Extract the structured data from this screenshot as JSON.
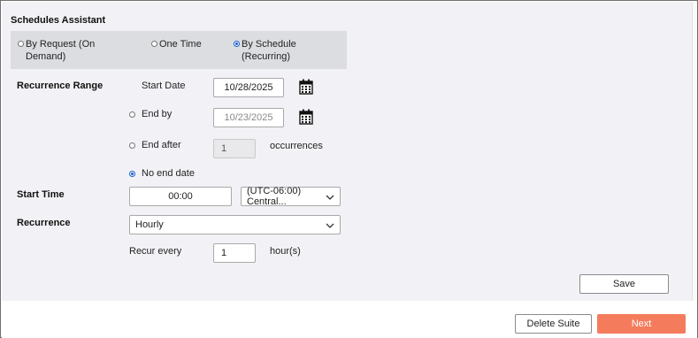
{
  "title": "Schedules Assistant",
  "modes": [
    {
      "label": "By Request (On Demand)",
      "checked": false
    },
    {
      "label": "One Time",
      "checked": false
    },
    {
      "label": "By Schedule (Recurring)",
      "checked": true
    }
  ],
  "recurrence_range": {
    "section_label": "Recurrence Range",
    "start_date_label": "Start Date",
    "start_date_value": "10/28/2025",
    "end_by_label": "End by",
    "end_by_value": "10/23/2025",
    "end_after_label": "End after",
    "end_after_value": "1",
    "occurrences_label": "occurrences",
    "no_end_label": "No end date",
    "selected": "no_end_date"
  },
  "start_time": {
    "section_label": "Start Time",
    "time_value": "00:00",
    "timezone_value": "(UTC-06:00) Central..."
  },
  "recurrence": {
    "section_label": "Recurrence",
    "frequency_value": "Hourly",
    "recur_every_label": "Recur every",
    "recur_every_value": "1",
    "unit_label": "hour(s)"
  },
  "buttons": {
    "save": "Save",
    "delete_suite": "Delete Suite",
    "next": "Next"
  },
  "colors": {
    "accent": "#f47c5c",
    "radio_selected": "#1a5fd0",
    "panel_bg": "#f2f2f6",
    "mode_bar_bg": "#dcdde0"
  },
  "icons": {
    "calendar": "calendar-icon",
    "dropdown": "chevron-down-icon"
  }
}
